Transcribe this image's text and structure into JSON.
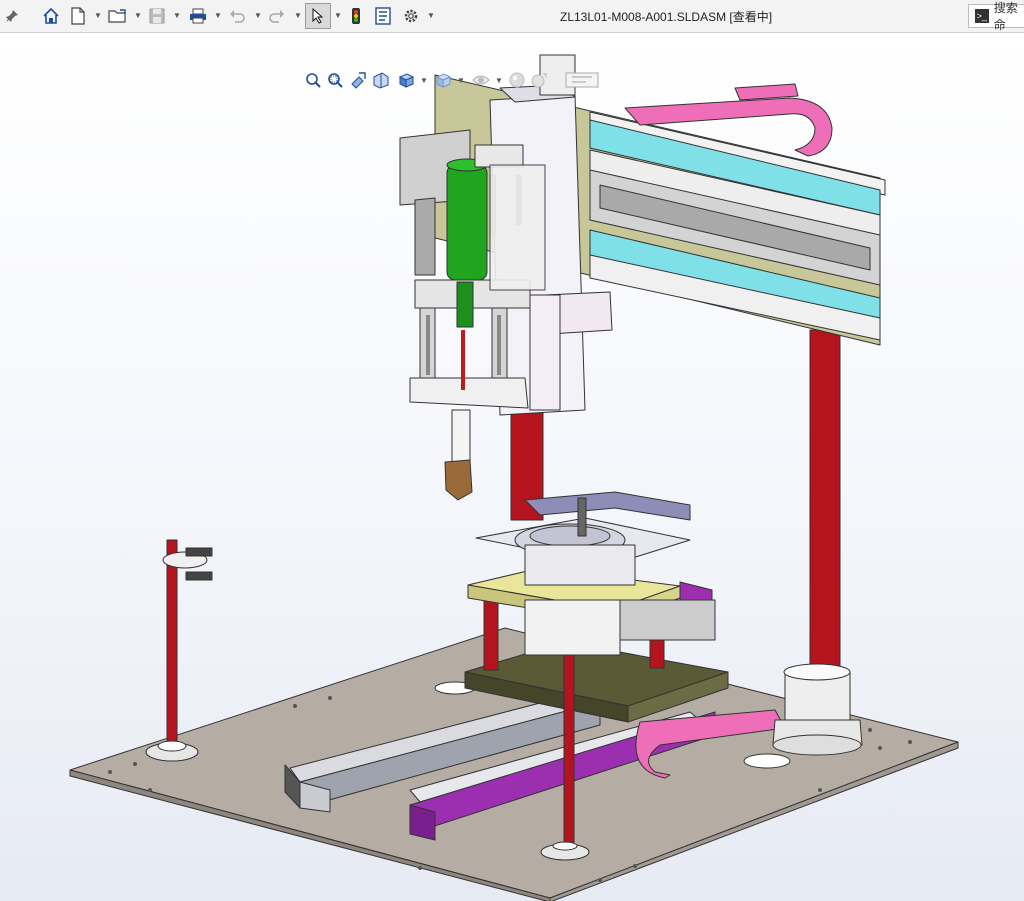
{
  "window": {
    "title": "ZL13L01-M008-A001.SLDASM [查看中]"
  },
  "search": {
    "label": "搜索命",
    "icon": "command-prompt-icon"
  },
  "toolbar": {
    "items": [
      {
        "icon": "pin-icon"
      },
      {
        "icon": "home-icon"
      },
      {
        "icon": "new-document-icon"
      },
      {
        "icon": "open-folder-icon"
      },
      {
        "icon": "save-icon"
      },
      {
        "icon": "print-icon"
      },
      {
        "icon": "undo-icon"
      },
      {
        "icon": "redo-icon"
      },
      {
        "icon": "select-cursor-icon"
      },
      {
        "icon": "rebuild-traffic-light-icon"
      },
      {
        "icon": "file-properties-icon"
      },
      {
        "icon": "options-gear-icon"
      }
    ]
  },
  "heads_up_toolbar": {
    "items": [
      {
        "icon": "zoom-to-fit-icon"
      },
      {
        "icon": "zoom-to-area-icon"
      },
      {
        "icon": "previous-view-icon"
      },
      {
        "icon": "section-view-icon"
      },
      {
        "icon": "view-orientation-icon"
      },
      {
        "icon": "display-style-icon"
      },
      {
        "icon": "hide-show-items-icon"
      },
      {
        "icon": "edit-appearance-icon"
      },
      {
        "icon": "apply-scene-icon"
      },
      {
        "icon": "view-settings-icon"
      }
    ]
  },
  "colors": {
    "accent_red": "#c0191f",
    "pink": "#ee6fb8",
    "cyan": "#7fe0e8",
    "green": "#1fa51f",
    "purple": "#9b2fb0",
    "olive": "#5a5a36",
    "yellow_plate": "#e9e59a",
    "base_plate": "#b5ada4"
  }
}
